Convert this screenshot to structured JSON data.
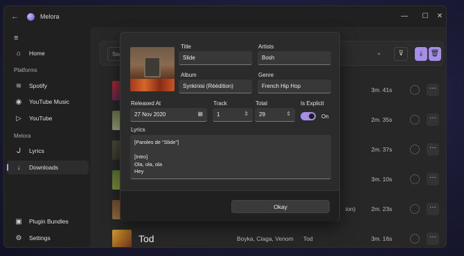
{
  "window": {
    "title": "Melora",
    "controls": {
      "minimize": "—",
      "maximize": "☐",
      "close": "✕"
    },
    "back_icon": "←"
  },
  "sidebar": {
    "menu_icon": "≡",
    "items_top": [
      {
        "label": "Home",
        "icon": "home-icon"
      }
    ],
    "platforms_header": "Platforms",
    "platforms": [
      {
        "label": "Spotify",
        "icon": "spotify-icon"
      },
      {
        "label": "YouTube Music",
        "icon": "youtube-music-icon"
      },
      {
        "label": "YouTube",
        "icon": "youtube-icon"
      }
    ],
    "melora_header": "Melora",
    "melora": [
      {
        "label": "Lyrics",
        "icon": "lyrics-icon"
      },
      {
        "label": "Downloads",
        "icon": "download-icon",
        "active": true
      }
    ],
    "bottom": [
      {
        "label": "Plugin Bundles",
        "icon": "plugin-icon"
      },
      {
        "label": "Settings",
        "icon": "gear-icon"
      }
    ]
  },
  "toolbar": {
    "search_placeholder": "Sea"
  },
  "tracks": [
    {
      "title": "",
      "artists": "",
      "genre": "",
      "duration": "3m. 41s"
    },
    {
      "title": "",
      "artists": "",
      "genre": "",
      "duration": "2m. 35s"
    },
    {
      "title": "",
      "artists": "",
      "genre": "",
      "duration": "2m. 37s"
    },
    {
      "title": "",
      "artists": "",
      "genre": "",
      "duration": "3m. 10s"
    },
    {
      "title": "",
      "artists": "",
      "genre": "ion)",
      "duration": "2m. 23s"
    },
    {
      "title": "Tod",
      "artists": "Boyka, Ciaga, Venom",
      "genre": "Tod",
      "duration": "3m. 16s"
    }
  ],
  "dialog": {
    "title_label": "Title",
    "title_value": "Slide",
    "artists_label": "Artists",
    "artists_value": "Bosh",
    "album_label": "Album",
    "album_value": "Synkinisi (Réédition)",
    "genre_label": "Genre",
    "genre_value": "French Hip Hop",
    "released_label": "Released At",
    "released_value": "27 Nov 2020",
    "track_label": "Track",
    "track_value": "1",
    "total_label": "Total",
    "total_value": "29",
    "explicit_label": "Is Explicit",
    "explicit_state": "On",
    "lyrics_label": "Lyrics",
    "lyrics_lines": [
      "[Paroles de \"Slide\"]",
      "",
      "[Intro]",
      "Ola, ola, ola",
      "Hey"
    ],
    "ok_label": "Okay"
  },
  "colors": {
    "accent": "#a58ee6",
    "window": "#202020",
    "content": "#272727",
    "dialog": "#2b2b2b"
  }
}
